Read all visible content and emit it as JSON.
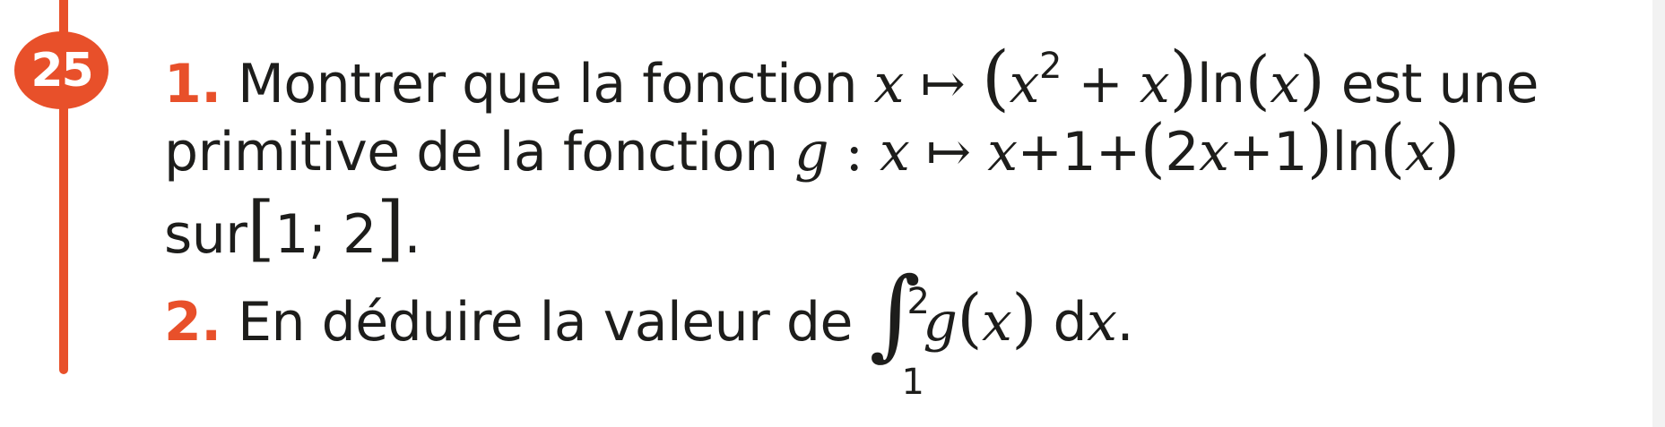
{
  "exercise": {
    "number": "25",
    "q1": {
      "label": "1.",
      "text_a": " Montrer que la fonction ",
      "text_b": " est une",
      "line2_text": "primitive de la fonction ",
      "line3_text": "sur"
    },
    "q2": {
      "label": "2.",
      "text_a": " En déduire la valeur de ",
      "integral_upper": "2",
      "integral_lower": "1"
    }
  }
}
